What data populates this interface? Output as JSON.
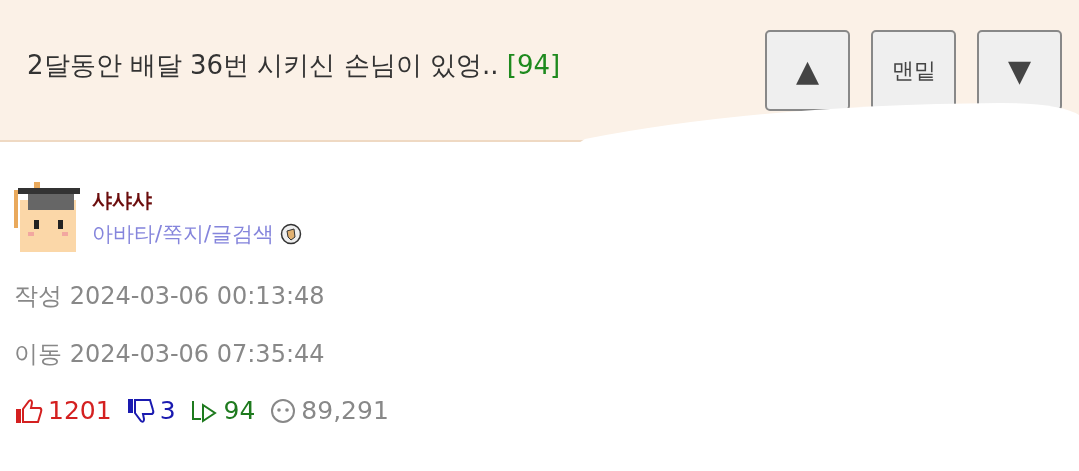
{
  "header": {
    "title": "2달동안 배달 36번 시키신 손님이 있엉..",
    "comment_count": "[94]",
    "buttons": [
      {
        "kind": "glyph",
        "label": "▲"
      },
      {
        "kind": "text",
        "label": "맨밑"
      },
      {
        "kind": "glyph",
        "label": "▼"
      }
    ]
  },
  "author": {
    "name": "샤샤샤",
    "links": "아바타/쪽지/글검색"
  },
  "meta": [
    {
      "label": "작성",
      "value": "2024-03-06 00:13:48"
    },
    {
      "label": "이동",
      "value": "2024-03-06 07:35:44"
    }
  ],
  "stats": [
    {
      "kind": "up",
      "value": "1201",
      "color": "#d42020"
    },
    {
      "kind": "down",
      "value": "3",
      "color": "#1a1ab0"
    },
    {
      "kind": "reply",
      "value": "94",
      "color": "#1e7a1e"
    },
    {
      "kind": "views",
      "value": "89,291",
      "color": "#888888"
    }
  ]
}
